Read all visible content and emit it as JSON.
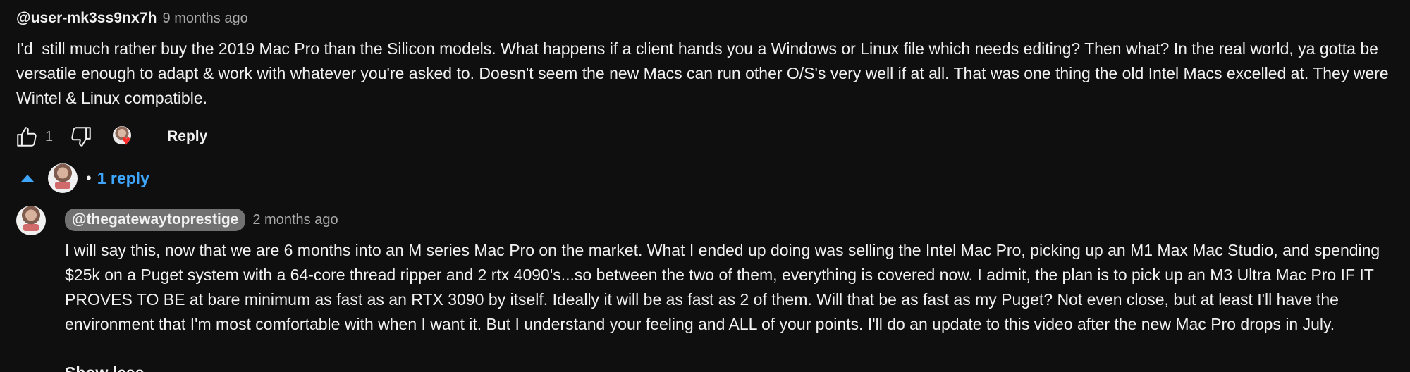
{
  "comment": {
    "author": "@user-mk3ss9nx7h",
    "time": "9 months ago",
    "text": "I'd  still much rather buy the 2019 Mac Pro than the Silicon models. What happens if a client hands you a Windows or Linux file which needs editing? Then what? In the real world, ya gotta be versatile enough to adapt & work with whatever you're asked to. Doesn't seem the new Macs can run other O/S's very well if at all. That was one thing the old Intel Macs excelled at. They were Wintel & Linux compatible.",
    "like_count": "1",
    "reply_label": "Reply",
    "icons": {
      "like": "thumbs-up-icon",
      "dislike": "thumbs-down-icon",
      "creator_heart": "creator-heart-icon",
      "heart_color": "#ff2a2a"
    }
  },
  "replies_toggle": {
    "label": "1 reply",
    "separator": "•",
    "accent_color": "#3ea6ff"
  },
  "reply": {
    "author": "@thegatewaytoprestige",
    "time": "2 months ago",
    "text": "I will say this, now that we are 6 months into an M series Mac Pro on the market. What I ended up doing was selling the Intel Mac Pro, picking up an M1 Max Mac Studio, and spending $25k on a Puget system with a 64-core thread ripper and 2 rtx 4090's...so between the two of them, everything is covered now. I admit, the plan is to pick up an M3 Ultra Mac Pro IF IT PROVES TO BE at bare minimum as fast as an RTX 3090 by itself. Ideally it will be as fast as 2 of them. Will that be as fast as my Puget? Not even close, but at least I'll have the environment that I'm most comfortable with when I want it. But I understand your feeling and ALL of your points. I'll do an update to this video after the new Mac Pro drops in July.",
    "cut_off_text": "Show less"
  }
}
